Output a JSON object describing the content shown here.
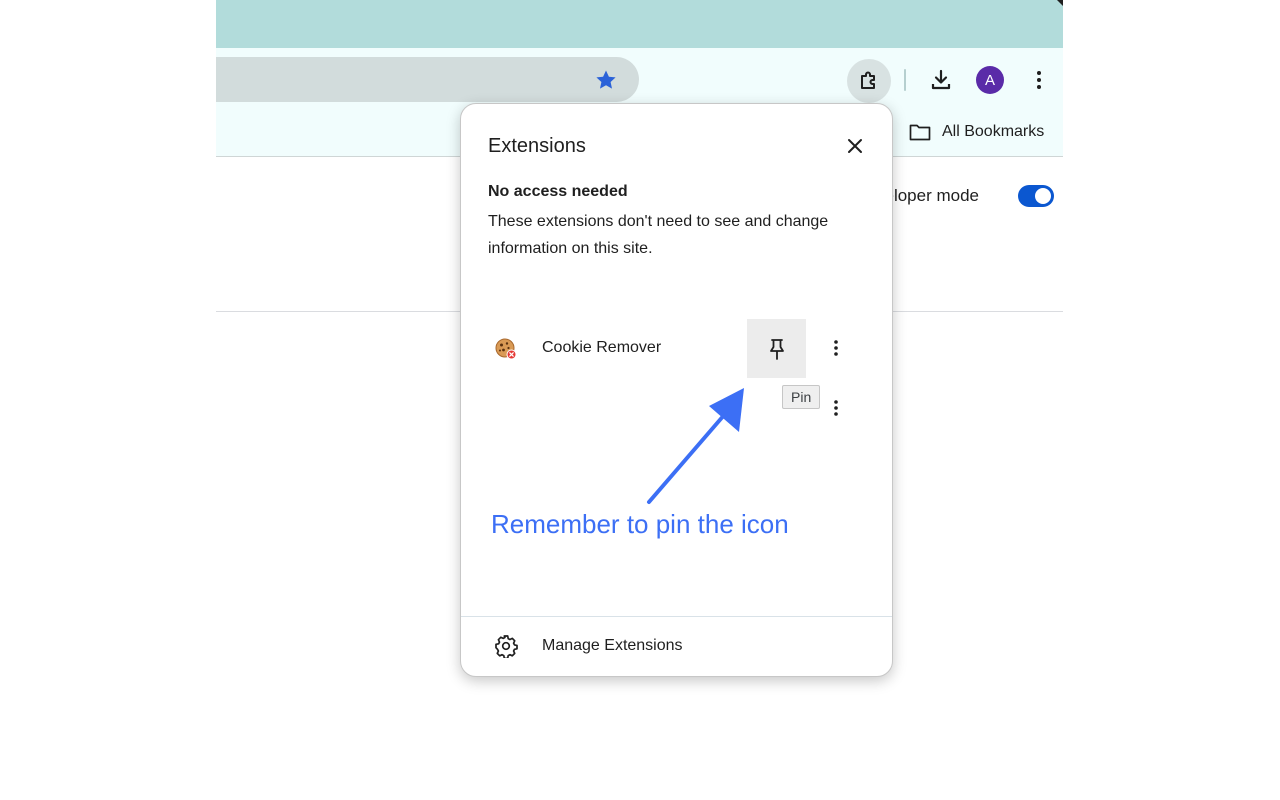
{
  "toolbar": {
    "avatar_initial": "A"
  },
  "bookmarks_bar": {
    "all_bookmarks_label": "All Bookmarks"
  },
  "page": {
    "developer_mode_label": "veloper mode",
    "developer_mode_on": true
  },
  "popup": {
    "title": "Extensions",
    "section_heading": "No access needed",
    "section_description": "These extensions don't need to see and change information on this site.",
    "extensions": [
      {
        "name": "Cookie Remover",
        "icon": "cookie-icon"
      }
    ],
    "pin_tooltip": "Pin",
    "manage_label": "Manage Extensions"
  },
  "annotation": {
    "text": "Remember to pin the icon",
    "color": "#3c6ff5"
  },
  "colors": {
    "tabstrip": "#b2dcdb",
    "toolbar": "#f1fdfd",
    "omnibox": "#d2dcdc",
    "accent": "#0b57d0",
    "avatar": "#5a2ba8"
  }
}
